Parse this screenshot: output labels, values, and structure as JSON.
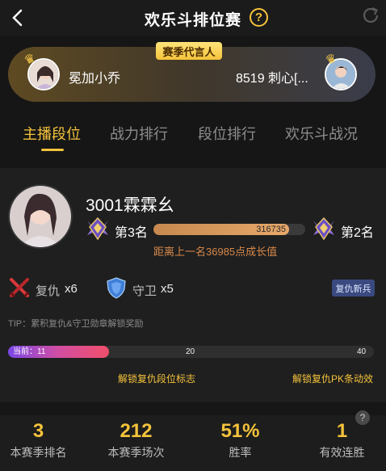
{
  "header": {
    "title": "欢乐斗排位赛",
    "help": "?"
  },
  "banner": {
    "tag": "赛季代言人",
    "left_name": "冕加小乔",
    "right_name": "8519 刺心[..."
  },
  "tabs": [
    {
      "label": "主播段位"
    },
    {
      "label": "战力排行"
    },
    {
      "label": "段位排行"
    },
    {
      "label": "欢乐斗战况"
    }
  ],
  "profile": {
    "name": "3001霖霖幺",
    "current_rank": "第3名",
    "next_rank": "第2名",
    "growth_value": "316735",
    "growth_fraction": 0.895,
    "gap_text": "距离上一名36985点成长值"
  },
  "medals": {
    "revenge_label": "复仇",
    "revenge_count": "x6",
    "guard_label": "守卫",
    "guard_count": "x5",
    "newbie_button": "复仇新兵"
  },
  "tip": "TIP：累积复仇&守卫勋章解锁奖励",
  "progress": {
    "current_label": "当前：11",
    "current_value": 11,
    "max_value": 40,
    "mid_label": "20",
    "end_label": "40"
  },
  "unlocks": {
    "first": "解锁复仇段位标志",
    "second": "解锁复仇PK条动效"
  },
  "stats": [
    {
      "value": "3",
      "label": "本赛季排名"
    },
    {
      "value": "212",
      "label": "本赛季场次"
    },
    {
      "value": "51%",
      "label": "胜率"
    },
    {
      "value": "1",
      "label": "有效连胜"
    }
  ],
  "colors": {
    "accent": "#f5c33b",
    "growth": "#d8884a",
    "background": "#161616"
  }
}
